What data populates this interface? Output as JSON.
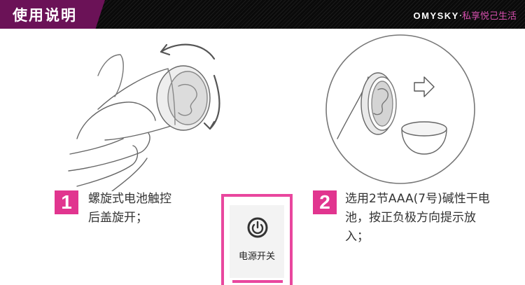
{
  "header": {
    "title": "使用说明",
    "brand": "OMYSKY",
    "separator": "·",
    "slogan": "私享悦己生活"
  },
  "steps": [
    {
      "number": "1",
      "lines": [
        "螺旋式电池触控",
        "后盖旋开；"
      ]
    },
    {
      "number": "2",
      "lines": [
        "选用2节AAA(7号)碱性干电",
        "池，按正负极方向提示放",
        "入；"
      ]
    }
  ],
  "power_switch": {
    "label": "电源开关",
    "icon": "power-icon"
  },
  "colors": {
    "header_bg": "#0a0a0a",
    "tab_bg": "#6b1257",
    "accent_pink": "#e1358f",
    "slogan_pink": "#d64fae"
  }
}
